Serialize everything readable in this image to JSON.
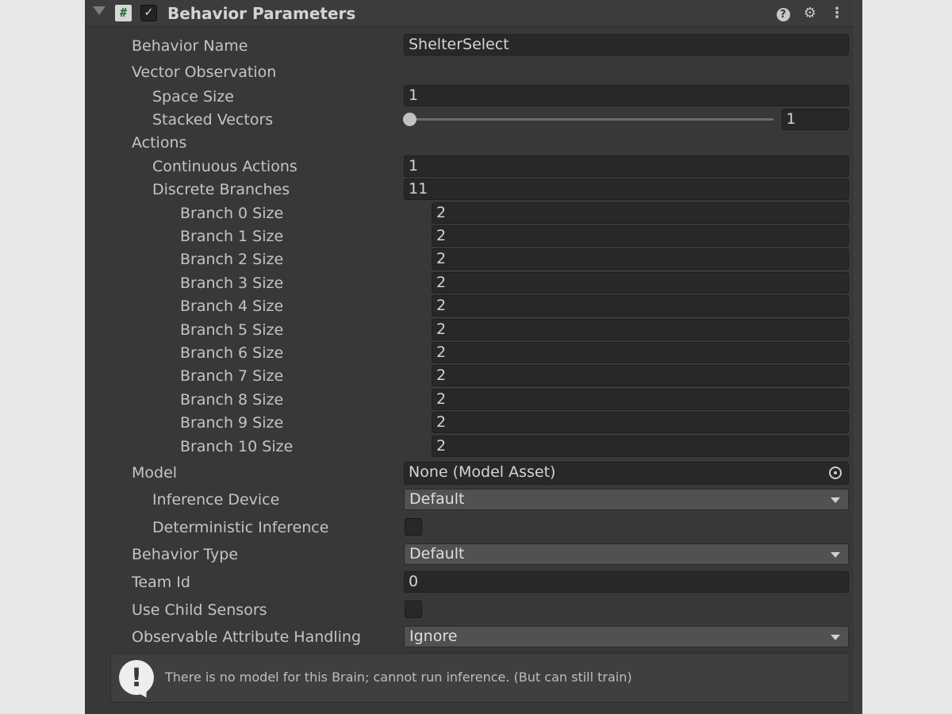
{
  "header": {
    "title": "Behavior Parameters",
    "script_icon_glyph": "#",
    "check_glyph": "✓",
    "help_glyph": "?",
    "presets_glyph": "⚙",
    "menu_glyph": "⋮"
  },
  "fields": {
    "behavior_name": {
      "label": "Behavior Name",
      "value": "ShelterSelect"
    },
    "vector_observation": {
      "label": "Vector Observation"
    },
    "space_size": {
      "label": "Space Size",
      "value": "1"
    },
    "stacked_vectors": {
      "label": "Stacked Vectors",
      "value": "1"
    },
    "actions": {
      "label": "Actions"
    },
    "continuous_actions": {
      "label": "Continuous Actions",
      "value": "1"
    },
    "discrete_branches": {
      "label": "Discrete Branches",
      "value": "11"
    },
    "branches": [
      {
        "label": "Branch 0 Size",
        "value": "2"
      },
      {
        "label": "Branch 1 Size",
        "value": "2"
      },
      {
        "label": "Branch 2 Size",
        "value": "2"
      },
      {
        "label": "Branch 3 Size",
        "value": "2"
      },
      {
        "label": "Branch 4 Size",
        "value": "2"
      },
      {
        "label": "Branch 5 Size",
        "value": "2"
      },
      {
        "label": "Branch 6 Size",
        "value": "2"
      },
      {
        "label": "Branch 7 Size",
        "value": "2"
      },
      {
        "label": "Branch 8 Size",
        "value": "2"
      },
      {
        "label": "Branch 9 Size",
        "value": "2"
      },
      {
        "label": "Branch 10 Size",
        "value": "2"
      }
    ],
    "model": {
      "label": "Model",
      "value": "None (Model Asset)"
    },
    "inference_device": {
      "label": "Inference Device",
      "value": "Default"
    },
    "deterministic_inference": {
      "label": "Deterministic Inference"
    },
    "behavior_type": {
      "label": "Behavior Type",
      "value": "Default"
    },
    "team_id": {
      "label": "Team Id",
      "value": "0"
    },
    "use_child_sensors": {
      "label": "Use Child Sensors"
    },
    "observable_attribute_handling": {
      "label": "Observable Attribute Handling",
      "value": "Ignore"
    }
  },
  "help_box": {
    "icon_glyph": "!",
    "message": "There is no model for this Brain; cannot run inference. (But can still train)"
  },
  "colors": {
    "panel_bg": "#383838",
    "field_bg": "#282828",
    "dropdown_bg": "#515151",
    "text": "#c4c4c4"
  }
}
